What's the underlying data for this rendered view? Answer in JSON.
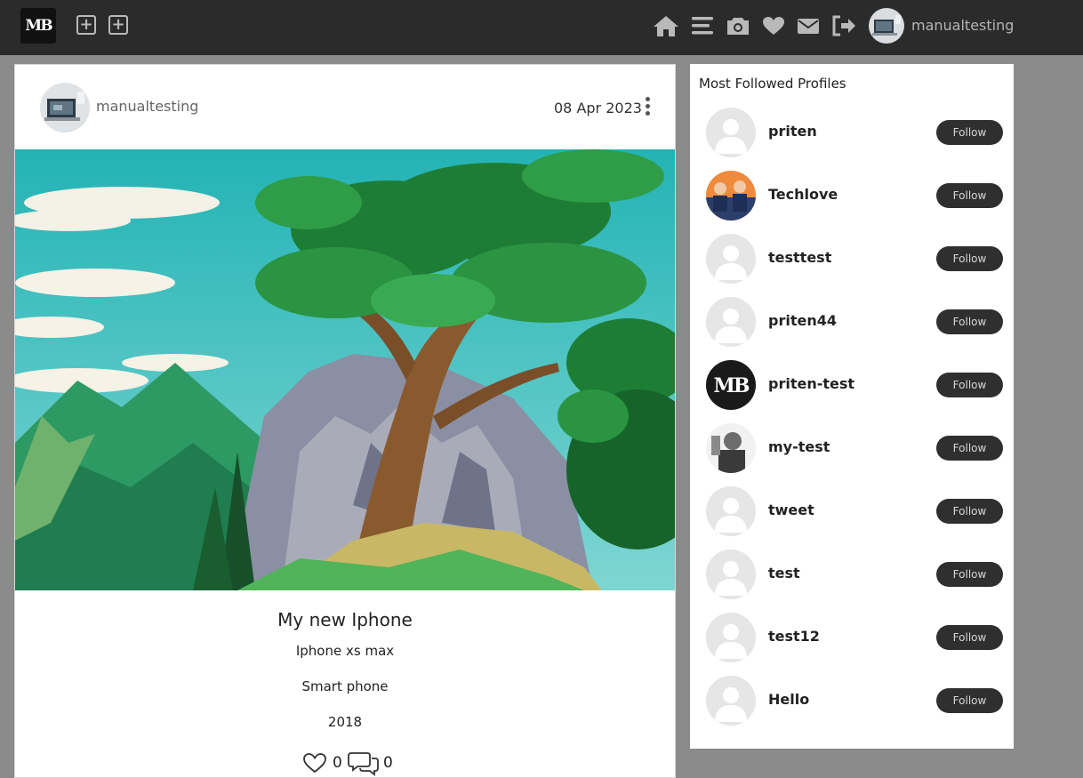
{
  "navbar": {
    "logo_text": "MB",
    "username": "manualtesting",
    "icons": [
      "plus-square-icon",
      "plus-square-icon",
      "home-icon",
      "menu-icon",
      "camera-icon",
      "heart-icon",
      "envelope-icon",
      "logout-icon"
    ]
  },
  "post": {
    "username": "manualtesting",
    "date": "08 Apr 2023",
    "title": "My new Iphone",
    "lines": [
      "Iphone xs max",
      "Smart phone",
      "2018"
    ],
    "likes": "0",
    "comments": "0"
  },
  "sidebar": {
    "title": "Most Followed Profiles",
    "follow_label": "Follow",
    "profiles": [
      {
        "name": "priten",
        "avatar": "default-avatar"
      },
      {
        "name": "Techlove",
        "avatar": "photo-avatar"
      },
      {
        "name": "testtest",
        "avatar": "default-avatar"
      },
      {
        "name": "priten44",
        "avatar": "default-avatar"
      },
      {
        "name": "priten-test",
        "avatar": "mb-logo-avatar"
      },
      {
        "name": "my-test",
        "avatar": "photo-avatar"
      },
      {
        "name": "tweet",
        "avatar": "default-avatar"
      },
      {
        "name": "test",
        "avatar": "default-avatar"
      },
      {
        "name": "test12",
        "avatar": "default-avatar"
      },
      {
        "name": "Hello",
        "avatar": "default-avatar"
      }
    ]
  },
  "colors": {
    "navbar_bg": "#2b2b2b",
    "page_bg": "#8c8b8c",
    "follow_button_bg": "#2f2f2f",
    "nav_icon": "#b9b9b9"
  }
}
